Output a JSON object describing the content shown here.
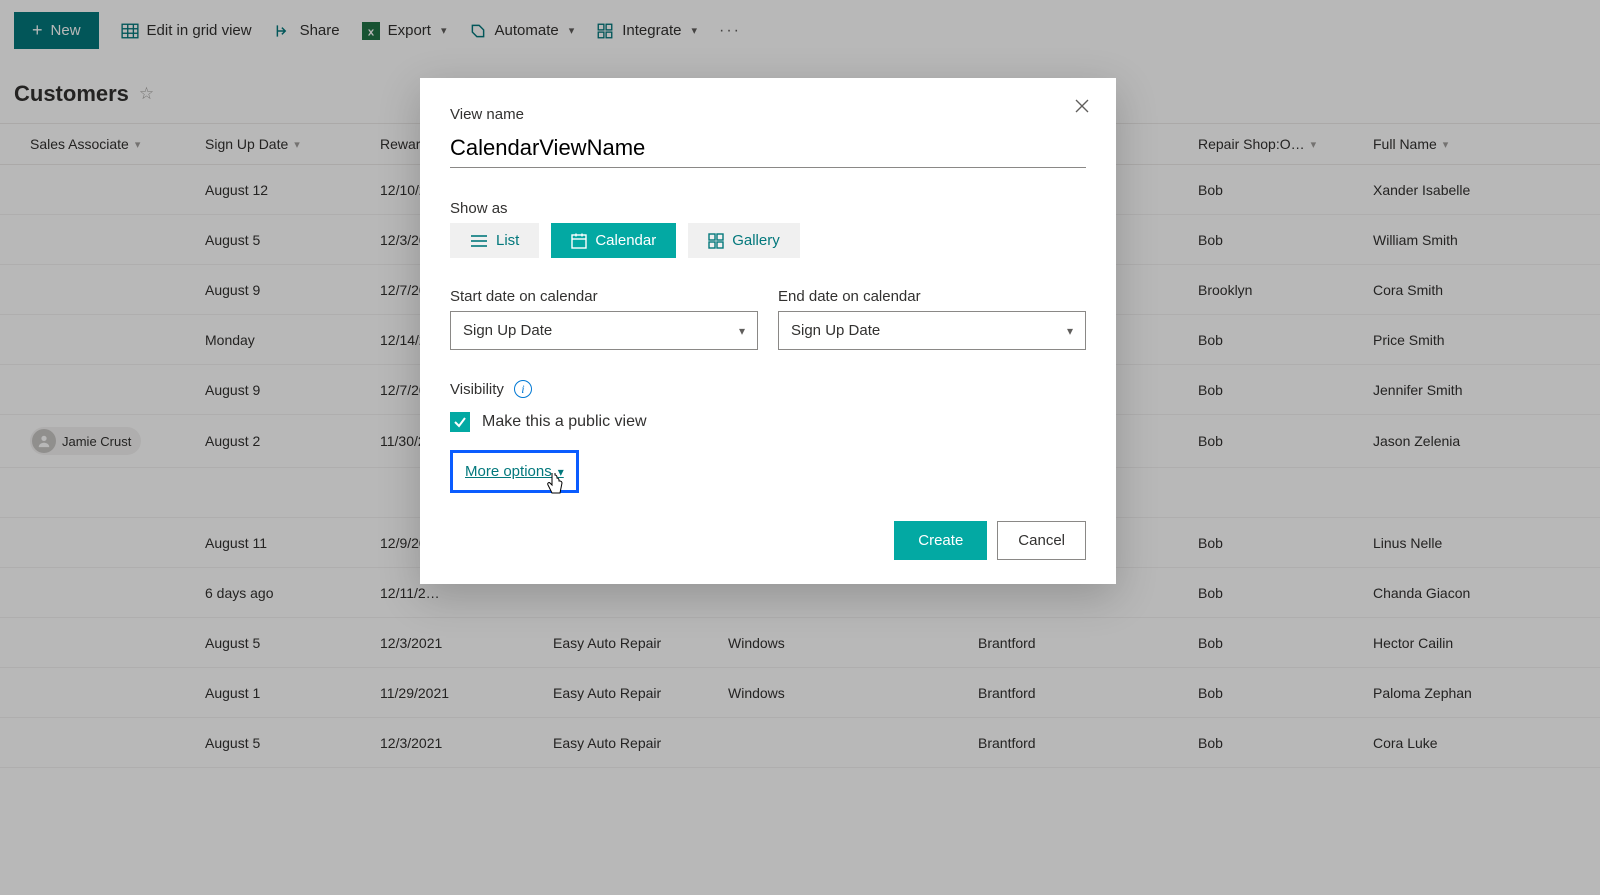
{
  "toolbar": {
    "new_label": "New",
    "edit_grid_label": "Edit in grid view",
    "share_label": "Share",
    "export_label": "Export",
    "automate_label": "Automate",
    "integrate_label": "Integrate"
  },
  "page": {
    "title": "Customers"
  },
  "columns": {
    "sales_associate": "Sales Associate",
    "sign_up_date": "Sign Up Date",
    "rewards": "Rewar",
    "repair_shop": "Repair Shop:O…",
    "full_name": "Full Name"
  },
  "rows": [
    {
      "sales": "",
      "signup": "August 12",
      "rewards": "12/10/2…",
      "company": "",
      "os": "",
      "city": "",
      "repair": "Bob",
      "fullname": "Xander Isabelle"
    },
    {
      "sales": "",
      "signup": "August 5",
      "rewards": "12/3/20…",
      "company": "",
      "os": "",
      "city": "",
      "repair": "Bob",
      "fullname": "William Smith"
    },
    {
      "sales": "",
      "signup": "August 9",
      "rewards": "12/7/20…",
      "company": "",
      "os": "",
      "city": "",
      "repair": "Brooklyn",
      "fullname": "Cora Smith"
    },
    {
      "sales": "",
      "signup": "Monday",
      "rewards": "12/14/2…",
      "company": "",
      "os": "",
      "city": "",
      "repair": "Bob",
      "fullname": "Price Smith"
    },
    {
      "sales": "",
      "signup": "August 9",
      "rewards": "12/7/20…",
      "company": "",
      "os": "",
      "city": "",
      "repair": "Bob",
      "fullname": "Jennifer Smith"
    },
    {
      "sales": "Jamie Crust",
      "signup": "August 2",
      "rewards": "11/30/2…",
      "company": "",
      "os": "",
      "city": "",
      "repair": "Bob",
      "fullname": "Jason Zelenia"
    },
    {
      "sales": "",
      "signup": "",
      "rewards": "",
      "company": "",
      "os": "",
      "city": "",
      "repair": "",
      "fullname": ""
    },
    {
      "sales": "",
      "signup": "August 11",
      "rewards": "12/9/20…",
      "company": "",
      "os": "",
      "city": "",
      "repair": "Bob",
      "fullname": "Linus Nelle"
    },
    {
      "sales": "",
      "signup": "6 days ago",
      "rewards": "12/11/2…",
      "company": "",
      "os": "",
      "city": "",
      "repair": "Bob",
      "fullname": "Chanda Giacon"
    },
    {
      "sales": "",
      "signup": "August 5",
      "rewards": "12/3/2021",
      "company": "Easy Auto Repair",
      "os": "Windows",
      "city": "Brantford",
      "repair": "Bob",
      "fullname": "Hector Cailin"
    },
    {
      "sales": "",
      "signup": "August 1",
      "rewards": "11/29/2021",
      "company": "Easy Auto Repair",
      "os": "Windows",
      "city": "Brantford",
      "repair": "Bob",
      "fullname": "Paloma Zephan"
    },
    {
      "sales": "",
      "signup": "August 5",
      "rewards": "12/3/2021",
      "company": "Easy Auto Repair",
      "os": "",
      "city": "Brantford",
      "repair": "Bob",
      "fullname": "Cora Luke"
    }
  ],
  "dialog": {
    "view_name_label": "View name",
    "view_name_value": "CalendarViewName",
    "show_as_label": "Show as",
    "list_label": "List",
    "calendar_label": "Calendar",
    "gallery_label": "Gallery",
    "start_date_label": "Start date on calendar",
    "start_date_value": "Sign Up Date",
    "end_date_label": "End date on calendar",
    "end_date_value": "Sign Up Date",
    "visibility_label": "Visibility",
    "public_view_label": "Make this a public view",
    "more_options_label": "More options",
    "create_label": "Create",
    "cancel_label": "Cancel"
  }
}
